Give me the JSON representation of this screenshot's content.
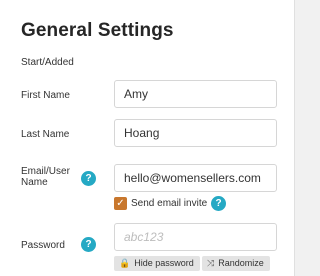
{
  "page": {
    "title": "General Settings",
    "section_label": "Start/Added"
  },
  "form": {
    "first_name": {
      "label": "First Name",
      "value": "Amy"
    },
    "last_name": {
      "label": "Last Name",
      "value": "Hoang"
    },
    "email": {
      "label": "Email/User Name",
      "value": "hello@womensellers.com",
      "help": "?"
    },
    "send_invite": {
      "label": "Send email invite",
      "checked": true,
      "check_glyph": "✓",
      "help": "?"
    },
    "password": {
      "label": "Password",
      "value": "",
      "placeholder": "abc123",
      "help": "?"
    },
    "actions": {
      "hide_password": {
        "icon": "lock-icon",
        "glyph": "🔒",
        "label": "Hide password"
      },
      "randomize": {
        "icon": "shuffle-icon",
        "glyph": "⤨",
        "label": "Randomize"
      }
    }
  },
  "colors": {
    "help_badge": "#25a9c4",
    "checkbox": "#c8772d"
  }
}
